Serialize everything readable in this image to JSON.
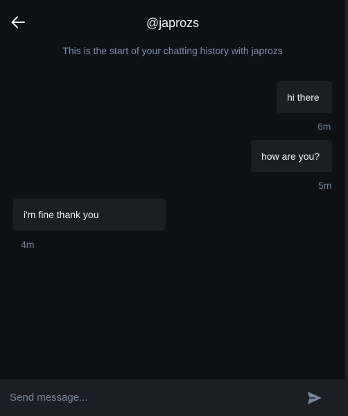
{
  "header": {
    "title": "@japrozs",
    "back_icon": "arrow-left-icon"
  },
  "history_note": "This is the start of your chatting history with japrozs",
  "messages": [
    {
      "text": "hi there",
      "time": "6m",
      "sender": "me"
    },
    {
      "text": "how are you?",
      "time": "5m",
      "sender": "me"
    },
    {
      "text": "i'm fine thank you",
      "time": "4m",
      "sender": "them"
    }
  ],
  "composer": {
    "value": "",
    "placeholder": "Send message...",
    "send_icon": "send-icon"
  },
  "colors": {
    "background": "#0d1116",
    "bubble": "#1b1f25",
    "muted_text": "#7d8fa9"
  }
}
